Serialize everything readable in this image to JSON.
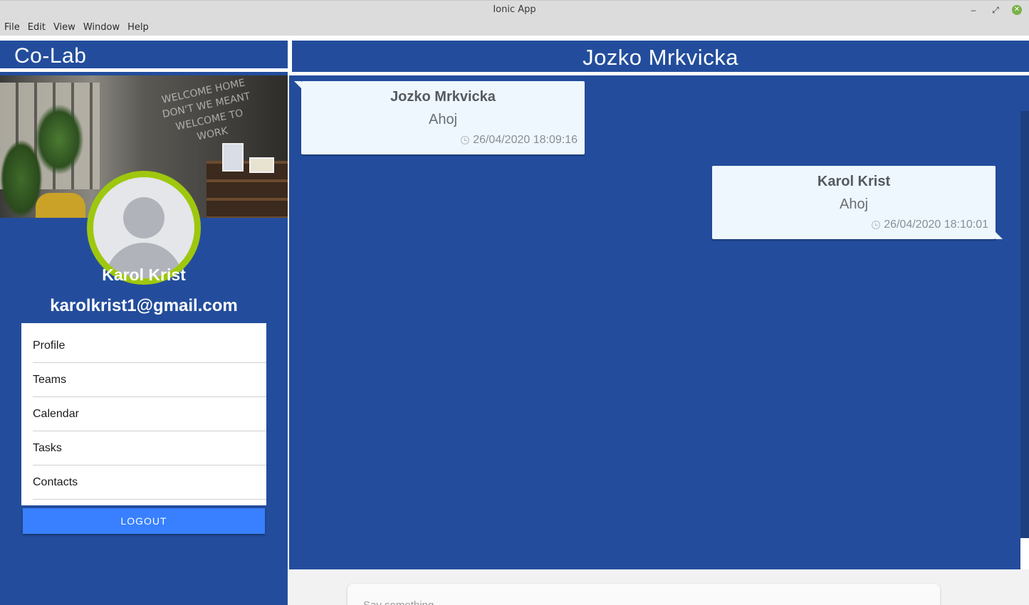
{
  "window": {
    "title": "Ionic App",
    "minimize": "–",
    "maximize": "⤢",
    "close": "✕"
  },
  "menubar": [
    "File",
    "Edit",
    "View",
    "Window",
    "Help"
  ],
  "sidebar": {
    "app_title": "Co-Lab",
    "cover_neon_text": "WELCOME HOME\nDON'T WE MEANT\nWELCOME TO WORK",
    "user_name": "Karol Krist",
    "user_email": "karolkrist1@gmail.com",
    "items": [
      {
        "label": "Profile"
      },
      {
        "label": "Teams"
      },
      {
        "label": "Calendar"
      },
      {
        "label": "Tasks"
      },
      {
        "label": "Contacts"
      }
    ],
    "logout_label": "LOGOUT"
  },
  "chat": {
    "title": "Jozko Mrkvicka",
    "messages": [
      {
        "sender": "Jozko Mrkvicka",
        "text": "Ahoj",
        "time": "26/04/2020 18:09:16",
        "side": "left"
      },
      {
        "sender": "Karol Krist",
        "text": "Ahoj",
        "time": "26/04/2020 18:10:01",
        "side": "right"
      }
    ],
    "input_placeholder": "Say something..."
  },
  "colors": {
    "primary": "#234d9c",
    "button": "#3880ff",
    "avatar_ring": "#9ec70e",
    "bubble": "#eef7fe"
  }
}
